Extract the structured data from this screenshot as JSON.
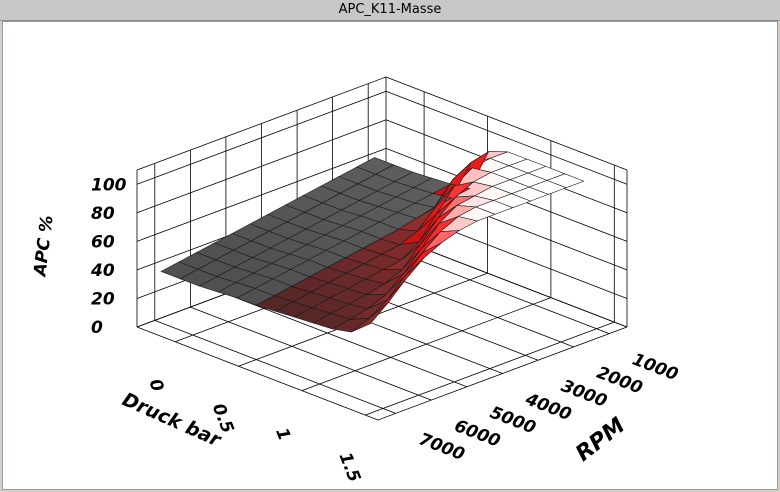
{
  "window": {
    "title": "APC_K11-Masse"
  },
  "chart_data": {
    "type": "surface3d",
    "title": "",
    "zlabel": "APC %",
    "xlabel": "RPM",
    "ylabel": "Druck bar",
    "rpm_ticks": [
      "1000",
      "2000",
      "3000",
      "4000",
      "5000",
      "6000",
      "7000"
    ],
    "druck_ticks": [
      "0",
      "0.5",
      "1",
      "1.5"
    ],
    "z_ticks": [
      "0",
      "20",
      "40",
      "60",
      "80",
      "100"
    ],
    "rpm_range": [
      500,
      7500
    ],
    "druck_range": [
      -0.3,
      1.6
    ],
    "z_range": [
      0,
      110
    ],
    "grid": true,
    "surface_rpm": [
      1000,
      1500,
      2000,
      2500,
      3000,
      3500,
      4000,
      4500,
      5000,
      5500,
      6000,
      6500,
      7000
    ],
    "surface_druck": [
      -0.25,
      -0.1,
      0.05,
      0.2,
      0.35,
      0.5,
      0.65,
      0.8,
      0.95,
      1.1,
      1.25,
      1.4
    ],
    "surface_apc": [
      [
        60,
        60,
        60,
        61,
        62,
        64,
        95,
        100,
        100,
        100,
        100,
        100
      ],
      [
        58,
        58,
        58,
        59,
        60,
        62,
        92,
        100,
        100,
        100,
        100,
        100
      ],
      [
        56,
        56,
        56,
        57,
        58,
        60,
        85,
        98,
        100,
        100,
        100,
        100
      ],
      [
        54,
        54,
        54,
        55,
        56,
        57,
        70,
        90,
        98,
        100,
        100,
        100
      ],
      [
        52,
        52,
        52,
        53,
        54,
        54,
        58,
        75,
        92,
        98,
        100,
        100
      ],
      [
        50,
        50,
        50,
        51,
        52,
        52,
        53,
        60,
        82,
        96,
        100,
        100
      ],
      [
        48,
        48,
        48,
        49,
        50,
        50,
        51,
        52,
        68,
        88,
        98,
        100
      ],
      [
        46,
        46,
        46,
        47,
        48,
        48,
        49,
        50,
        55,
        75,
        92,
        98
      ],
      [
        44,
        44,
        44,
        45,
        46,
        46,
        47,
        48,
        50,
        62,
        82,
        94
      ],
      [
        42,
        42,
        42,
        43,
        44,
        44,
        45,
        46,
        47,
        52,
        70,
        88
      ],
      [
        40,
        40,
        40,
        41,
        42,
        42,
        43,
        44,
        45,
        47,
        58,
        78
      ],
      [
        38,
        38,
        38,
        39,
        40,
        40,
        41,
        42,
        43,
        44,
        50,
        66
      ],
      [
        36,
        36,
        36,
        37,
        38,
        38,
        39,
        40,
        41,
        42,
        45,
        56
      ]
    ]
  }
}
